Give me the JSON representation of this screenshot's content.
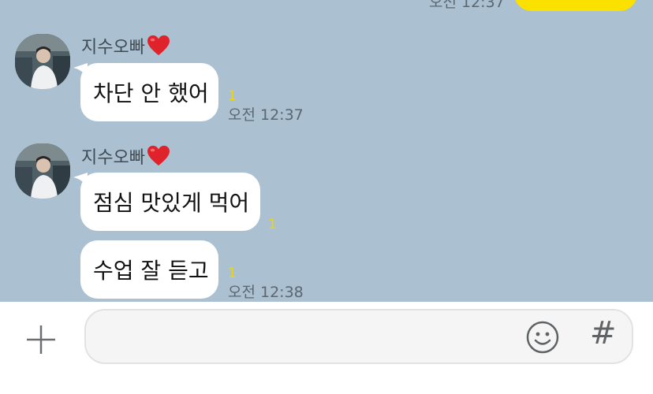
{
  "chat": {
    "top_partial_time": "오전 12:37",
    "groups": [
      {
        "sender": "지수오빠",
        "messages": [
          {
            "text": "차단 안 했어",
            "unread": "1",
            "time": "오전 12:37"
          }
        ]
      },
      {
        "sender": "지수오빠",
        "messages": [
          {
            "text": "점심 맛있게 먹어",
            "unread": "1",
            "time": ""
          },
          {
            "text": "수업 잘 듣고",
            "unread": "1",
            "time": "오전 12:38"
          }
        ]
      }
    ]
  },
  "input_bar": {
    "message_value": "",
    "message_placeholder": "",
    "hash_label": "#"
  },
  "icons": {
    "plus": "plus-icon",
    "emoji": "smiley-icon",
    "heart": "red-heart-emoji"
  },
  "colors": {
    "chat_background": "#abc1d1",
    "my_bubble": "#fae100",
    "their_bubble": "#ffffff",
    "unread_count": "#f2d500"
  }
}
